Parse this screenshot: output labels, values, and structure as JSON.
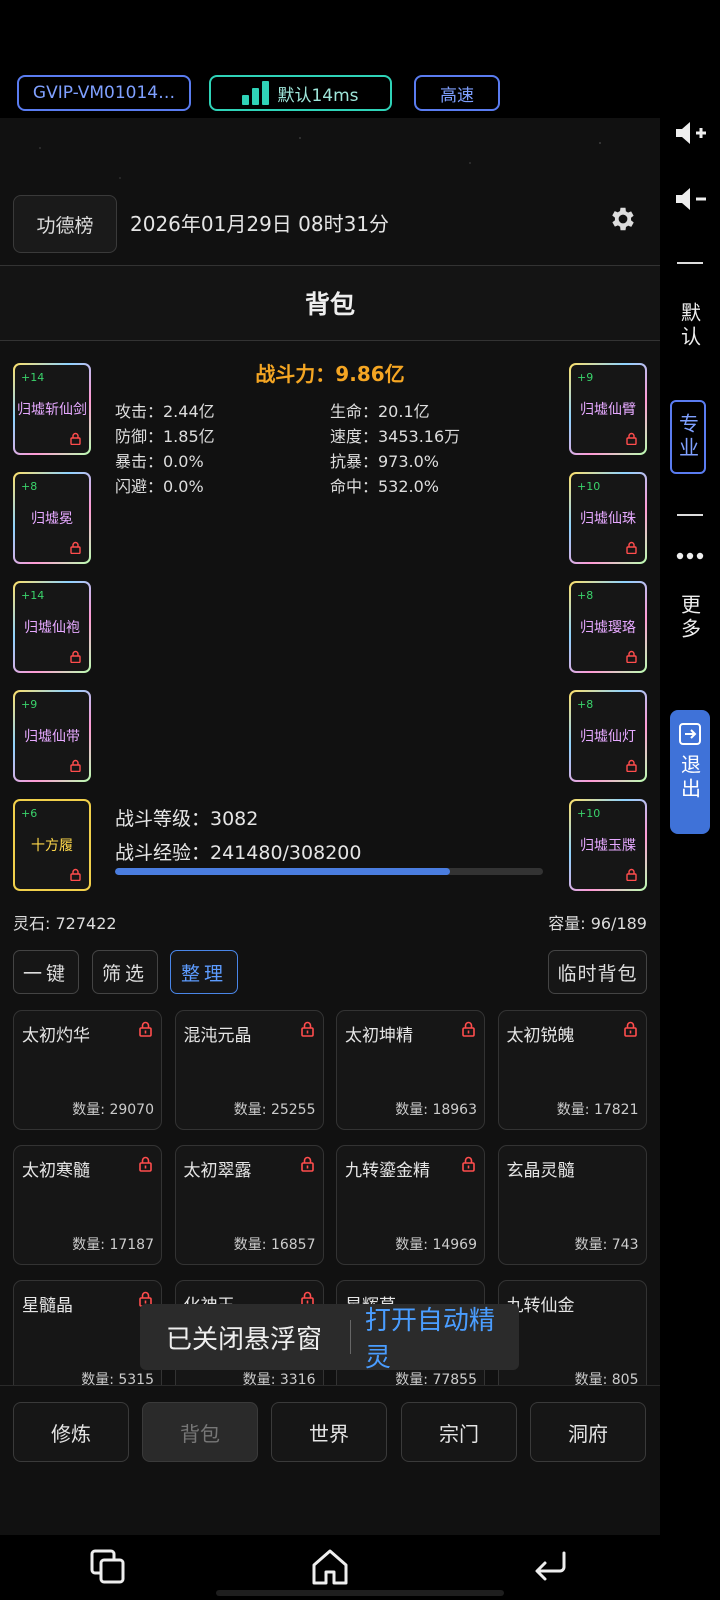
{
  "topbar": {
    "vm_label": "GVIP-VM01014…",
    "network_label": "默认14ms",
    "speed_label": "高速"
  },
  "header": {
    "gongde_label": "功德榜",
    "datetime": "2026年01月29日 08时31分",
    "page_title": "背包"
  },
  "equipment": {
    "left": [
      {
        "level": "+14",
        "name": "归墟斩仙剑"
      },
      {
        "level": "+8",
        "name": "归墟冕"
      },
      {
        "level": "+14",
        "name": "归墟仙袍"
      },
      {
        "level": "+9",
        "name": "归墟仙带"
      },
      {
        "level": "+6",
        "name": "十方履"
      }
    ],
    "right": [
      {
        "level": "+9",
        "name": "归墟仙臂"
      },
      {
        "level": "+10",
        "name": "归墟仙珠"
      },
      {
        "level": "+8",
        "name": "归墟璎珞"
      },
      {
        "level": "+8",
        "name": "归墟仙灯"
      },
      {
        "level": "+10",
        "name": "归墟玉牒"
      }
    ]
  },
  "stats": {
    "power": "战斗力：9.86亿",
    "attack": "攻击：2.44亿",
    "hp": "生命：20.1亿",
    "defense": "防御：1.85亿",
    "speed": "速度：3453.16万",
    "crit": "暴击：0.0%",
    "crit_resist": "抗暴：973.0%",
    "dodge": "闪避：0.0%",
    "hit": "命中：532.0%",
    "combat_level": "战斗等级：3082",
    "combat_exp": "战斗经验：241480/308200",
    "exp_fraction": 0.7835
  },
  "inventory": {
    "lingshi": "灵石:  727422",
    "capacity": "容量:  96/189",
    "btn_onekey": "一键",
    "btn_filter": "筛选",
    "btn_sort": "整理",
    "btn_temp": "临时背包",
    "items": [
      {
        "name": "太初灼华",
        "qty": "数量: 29070",
        "locked": true
      },
      {
        "name": "混沌元晶",
        "qty": "数量: 25255",
        "locked": true
      },
      {
        "name": "太初坤精",
        "qty": "数量: 18963",
        "locked": true
      },
      {
        "name": "太初锐魄",
        "qty": "数量: 17821",
        "locked": true
      },
      {
        "name": "太初寒髓",
        "qty": "数量: 17187",
        "locked": true
      },
      {
        "name": "太初翠露",
        "qty": "数量: 16857",
        "locked": true
      },
      {
        "name": "九转鎏金精",
        "qty": "数量: 14969",
        "locked": true
      },
      {
        "name": "玄晶灵髓",
        "qty": "数量: 743",
        "locked": false
      },
      {
        "name": "星髓晶",
        "qty": "数量: 5315",
        "locked": true
      },
      {
        "name": "化神玉",
        "qty": "数量: 3316",
        "locked": true
      },
      {
        "name": "星辉草",
        "qty": "数量: 77855",
        "locked": false
      },
      {
        "name": "九转仙金",
        "qty": "数量: 805",
        "locked": false
      }
    ]
  },
  "toast": {
    "message": "已关闭悬浮窗",
    "action": "打开自动精灵"
  },
  "tabs": {
    "t1": "修炼",
    "t2": "背包",
    "t3": "世界",
    "t4": "宗门",
    "t5": "洞府"
  },
  "sidepanel": {
    "default_label": "默认",
    "pro_label": "专业",
    "more_label": "更多",
    "exit_label": "退出"
  }
}
